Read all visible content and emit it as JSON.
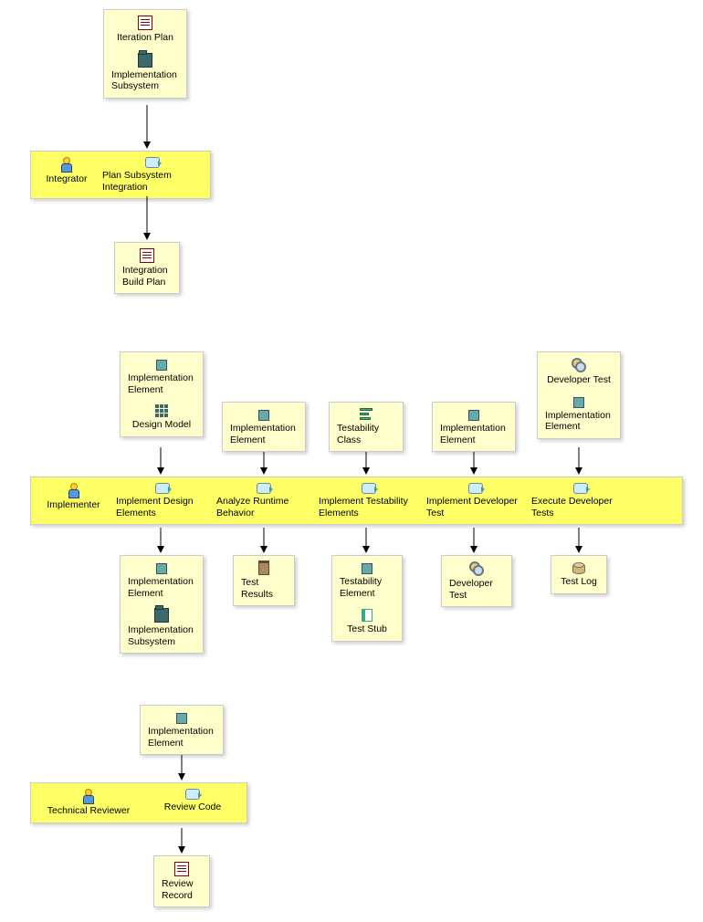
{
  "section1": {
    "input": {
      "iterationPlan": "Iteration Plan",
      "implSubsystem": "Implementation Subsystem"
    },
    "activity": {
      "role": "Integrator",
      "task": "Plan Subsystem Integration"
    },
    "output": {
      "buildPlan": "Integration Build Plan"
    }
  },
  "section2": {
    "role": "Implementer",
    "columns": [
      {
        "inputs": [
          {
            "icon": "square",
            "label": "Implementation Element"
          },
          {
            "icon": "pattern",
            "label": "Design Model"
          }
        ],
        "task": "Implement Design Elements",
        "outputs": [
          {
            "icon": "square",
            "label": "Implementation Element"
          },
          {
            "icon": "pkg",
            "label": "Implementation Subsystem"
          }
        ]
      },
      {
        "inputs": [
          {
            "icon": "square",
            "label": "Implementation Element"
          }
        ],
        "task": "Analyze Runtime Behavior",
        "outputs": [
          {
            "icon": "trash",
            "label": "Test Results"
          }
        ]
      },
      {
        "inputs": [
          {
            "icon": "bars",
            "label": "Testability Class"
          }
        ],
        "task": "Implement Testability Elements",
        "outputs": [
          {
            "icon": "square",
            "label": "Testability Element"
          },
          {
            "icon": "book",
            "label": "Test Stub"
          }
        ]
      },
      {
        "inputs": [
          {
            "icon": "square",
            "label": "Implementation Element"
          }
        ],
        "task": "Implement Developer Test",
        "outputs": [
          {
            "icon": "gears",
            "label": "Developer Test"
          }
        ]
      },
      {
        "inputs": [
          {
            "icon": "gears",
            "label": "Developer Test"
          },
          {
            "icon": "square",
            "label": "Implementation Element"
          }
        ],
        "task": "Execute Developer Tests",
        "outputs": [
          {
            "icon": "cyl",
            "label": "Test Log"
          }
        ]
      }
    ]
  },
  "section3": {
    "input": {
      "icon": "square",
      "label": "Implementation Element"
    },
    "activity": {
      "role": "Technical Reviewer",
      "task": "Review Code"
    },
    "output": {
      "icon": "doc",
      "label": "Review Record"
    }
  }
}
